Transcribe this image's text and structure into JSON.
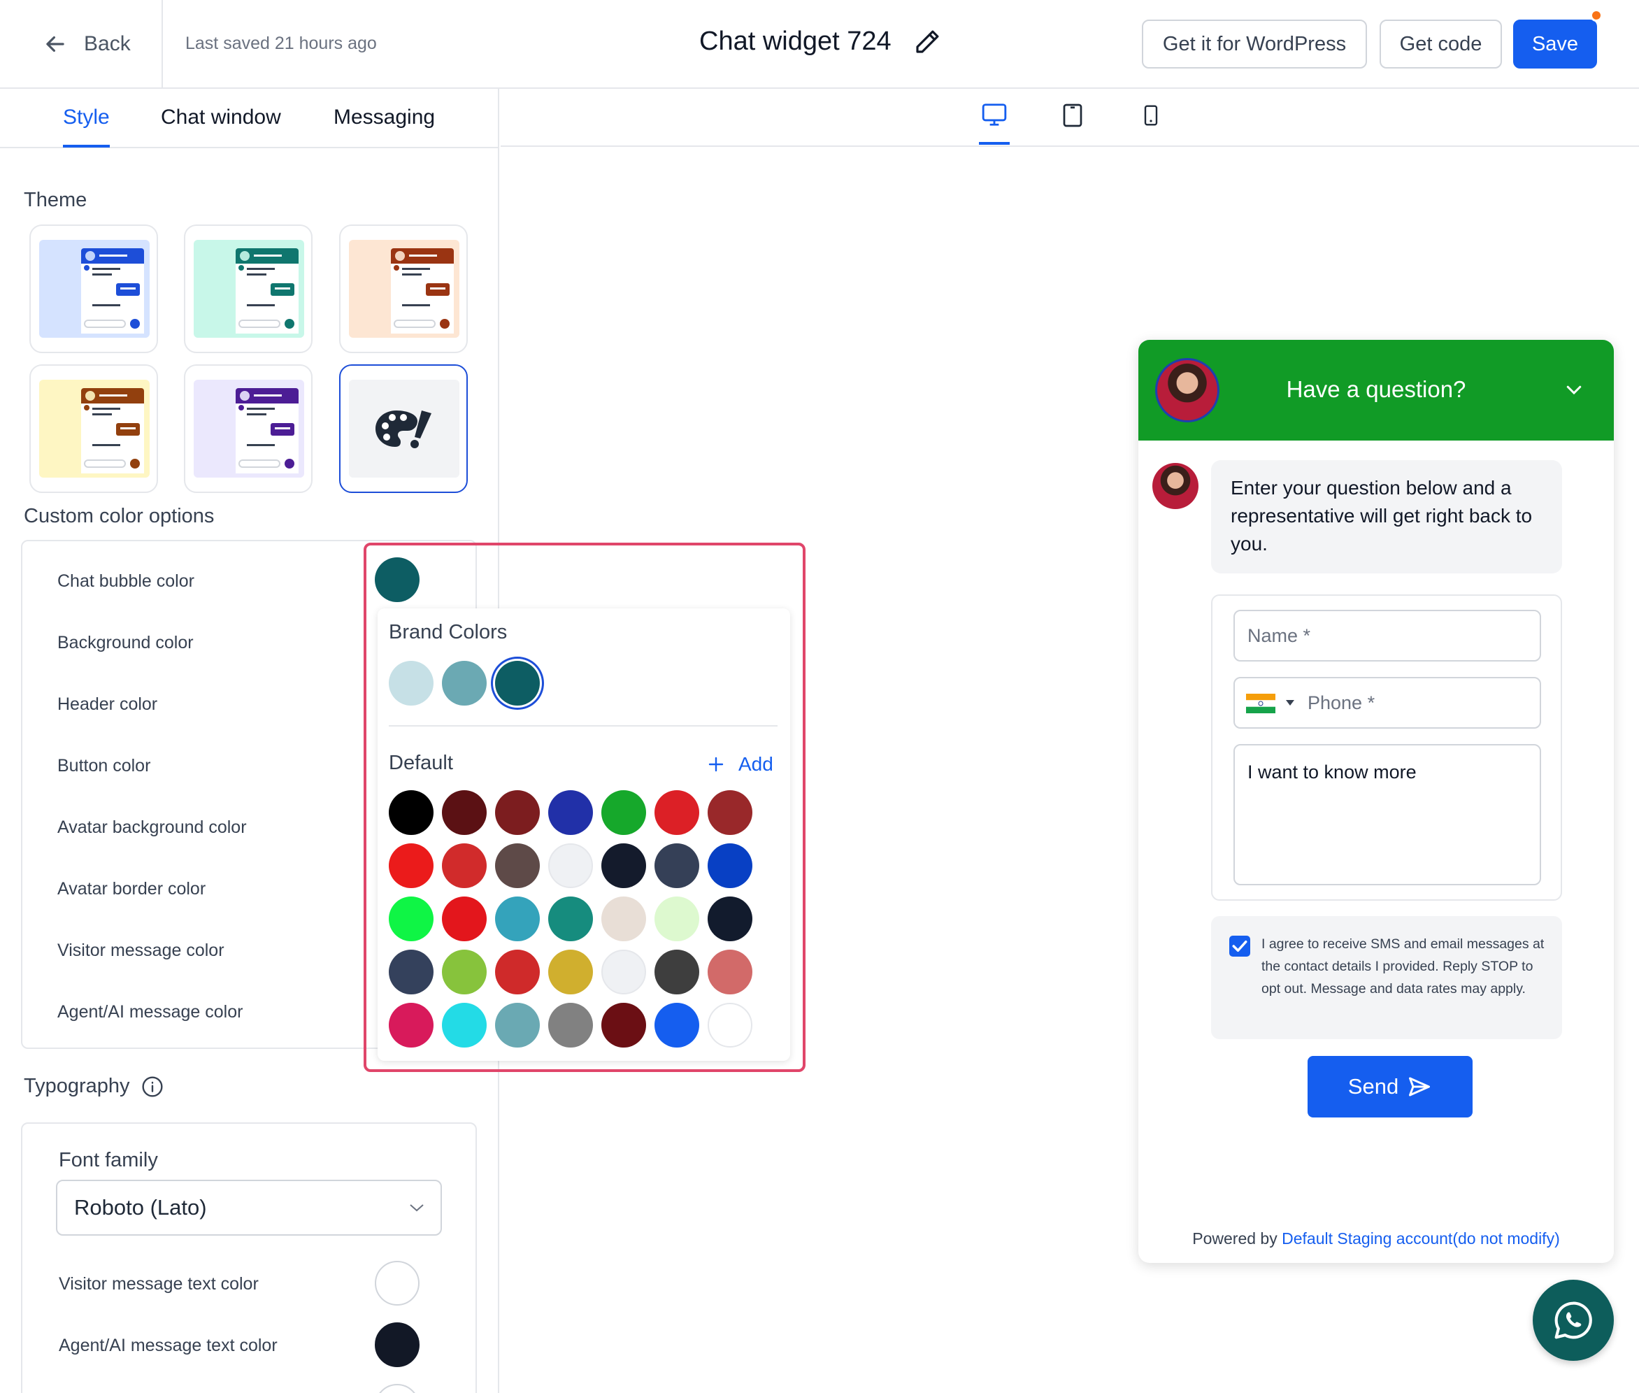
{
  "topbar": {
    "back_label": "Back",
    "last_saved": "Last saved 21 hours ago",
    "title": "Chat widget 724",
    "wordpress_label": "Get it for WordPress",
    "get_code_label": "Get code",
    "save_label": "Save"
  },
  "tabs": [
    "Style",
    "Chat window",
    "Messaging"
  ],
  "theme": {
    "title": "Theme",
    "cards": [
      {
        "bg": "#d5e3ff",
        "accent": "#1d4ed8"
      },
      {
        "bg": "#c8f7e9",
        "accent": "#0f766e"
      },
      {
        "bg": "#fde6d3",
        "accent": "#9a3412"
      },
      {
        "bg": "#fef6c3",
        "accent": "#92400e"
      },
      {
        "bg": "#ebe8fd",
        "accent": "#4c1d95"
      }
    ],
    "custom_icon": "palette-icon"
  },
  "custom_colors": {
    "title": "Custom color options",
    "rows": [
      "Chat bubble color",
      "Background color",
      "Header color",
      "Button color",
      "Avatar background color",
      "Avatar border color",
      "Visitor message color",
      "Agent/AI message color"
    ],
    "current_color": "#0d5d63"
  },
  "picker": {
    "brand_title": "Brand Colors",
    "brand": [
      "#c6e0e6",
      "#6ba9b3",
      "#0d5d63"
    ],
    "default_title": "Default",
    "add_label": "Add",
    "defaults": [
      [
        "#000000",
        "#5b1114",
        "#7c1d1f",
        "#2130a8",
        "#16a82b",
        "#dc2026",
        "#99282a"
      ],
      [
        "#eb1b1b",
        "#d12b2b",
        "#5e4a48",
        "#eff1f4",
        "#141b2c",
        "#354057",
        "#0840c4"
      ],
      [
        "#0ff545",
        "#e3161c",
        "#34a3bb",
        "#168c7e",
        "#e8ded6",
        "#ddf9cf",
        "#121b2d"
      ],
      [
        "#34415c",
        "#87c33c",
        "#cf2a2a",
        "#d0af2e",
        "#eff1f4",
        "#3e3e3e",
        "#d26a69"
      ],
      [
        "#d81a5b",
        "#23dbe6",
        "#6aa9b3",
        "#818181",
        "#6b0f14",
        "#155eef",
        "#ffffff"
      ]
    ]
  },
  "typography": {
    "title": "Typography",
    "font_family_label": "Font family",
    "font_value": "Roboto (Lato)",
    "visitor_text_label": "Visitor message text color",
    "visitor_text_color": "#ffffff",
    "agent_text_label": "Agent/AI message text color",
    "agent_text_color": "#121826"
  },
  "chat": {
    "header_title": "Have a question?",
    "header_color": "#119b26",
    "intro": "Enter your question below and a representative will get right back to you.",
    "name_placeholder": "Name *",
    "phone_placeholder": "Phone *",
    "message_value": "I want to know more",
    "consent": "I agree to receive SMS and email messages at the contact details I provided. Reply STOP to opt out. Message and data rates may apply.",
    "send_label": "Send",
    "powered_prefix": "Powered by",
    "powered_link": "Default Staging account(do not modify)"
  }
}
